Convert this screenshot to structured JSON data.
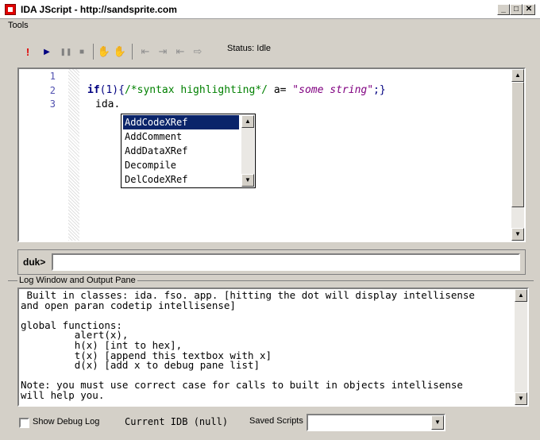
{
  "window": {
    "title": "IDA JScript - http://sandsprite.com"
  },
  "menu": {
    "tools": "Tools"
  },
  "toolbar": {
    "status": "Status: Idle"
  },
  "editor": {
    "line_numbers": [
      "1",
      "2",
      "3"
    ],
    "line2": {
      "kw": "if",
      "paren": "(1){",
      "comment": "/*syntax highlighting*/",
      "var": "a=",
      "string": "\"some string\"",
      "end": ";}"
    },
    "line3": "ida."
  },
  "autocomplete": {
    "items": [
      "AddCodeXRef",
      "AddComment",
      "AddDataXRef",
      "Decompile",
      "DelCodeXRef"
    ]
  },
  "console": {
    "label": "duk>",
    "value": ""
  },
  "log": {
    "group_label": "Log Window and Output Pane",
    "text": " Built in classes: ida. fso. app. [hitting the dot will display intellisense\nand open paran codetip intellisense]\n\nglobal functions:\n         alert(x),\n         h(x) [int to hex],\n         t(x) [append this textbox with x]\n         d(x) [add x to debug pane list]\n\nNote: you must use correct case for calls to built in objects intellisense\nwill help you."
  },
  "bottom": {
    "show_debug_log": "Show Debug Log",
    "current_idb": "Current IDB (null)",
    "saved_scripts": "Saved Scripts",
    "saved_scripts_value": ""
  },
  "colors": {
    "keyword": "#000080",
    "comment": "#008000",
    "string": "#800080",
    "selection": "#0a246a"
  }
}
